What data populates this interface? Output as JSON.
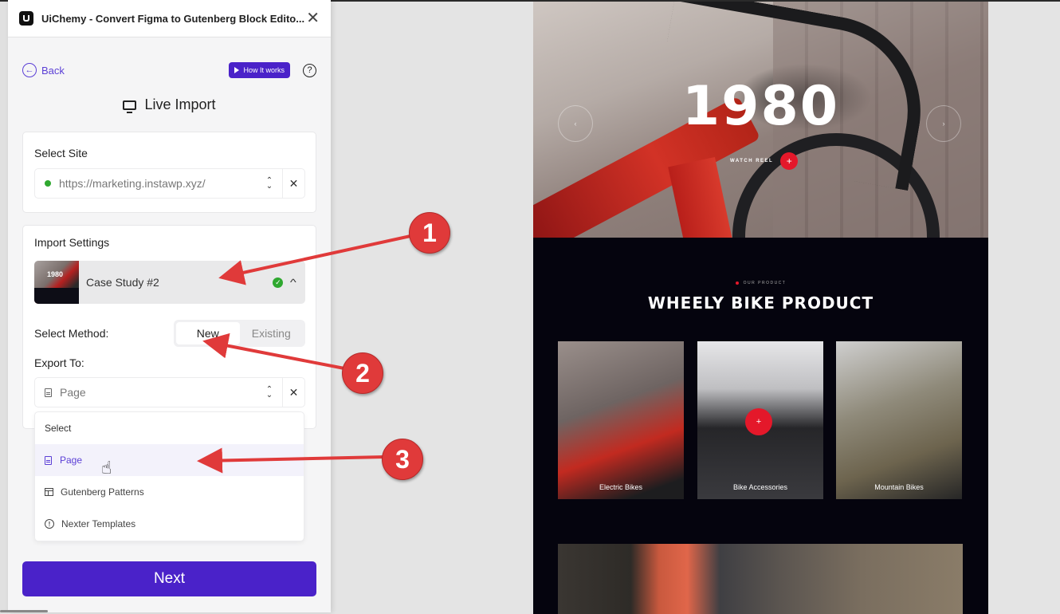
{
  "panel": {
    "title": "UiChemy - Convert Figma to Gutenberg Block Edito...",
    "close_icon": "close-icon",
    "back_label": "Back",
    "how_it_works_label": "How It works",
    "help_icon": "question-icon",
    "page_title": "Live Import",
    "page_title_icon": "monitor-icon"
  },
  "select_site": {
    "label": "Select Site",
    "value": "https://marketing.instawp.xyz/",
    "status_color": "#2fa82f"
  },
  "import_settings": {
    "label": "Import Settings",
    "design_name": "Case Study #2",
    "thumbnail_text": "1980",
    "status": "check-icon",
    "select_method_label": "Select Method:",
    "methods": [
      {
        "label": "New",
        "active": true
      },
      {
        "label": "Existing",
        "active": false
      }
    ],
    "export_to_label": "Export To:",
    "export_to_value": "Page"
  },
  "dropdown": {
    "items": [
      {
        "label": "Select",
        "icon": ""
      },
      {
        "label": "Page",
        "icon": "page-icon",
        "hovered": true
      },
      {
        "label": "Gutenberg Patterns",
        "icon": "patterns-icon"
      },
      {
        "label": "Nexter Templates",
        "icon": "info-icon"
      }
    ]
  },
  "next_label": "Next",
  "annotations": [
    "1",
    "2",
    "3"
  ],
  "colors": {
    "brand": "#4a22c9",
    "annotation": "#e03a3a",
    "accent_red": "#e4182a"
  },
  "preview": {
    "hero_year": "1980",
    "watch_reel": "WATCH REEL",
    "prev_arrow": "‹",
    "next_arrow": "›",
    "eyebrow": "OUR PRODUCT",
    "section_title": "WHEELY BIKE PRODUCT",
    "products": [
      {
        "label": "Electric Bikes"
      },
      {
        "label": "Bike Accessories"
      },
      {
        "label": "Mountain Bikes"
      }
    ]
  }
}
